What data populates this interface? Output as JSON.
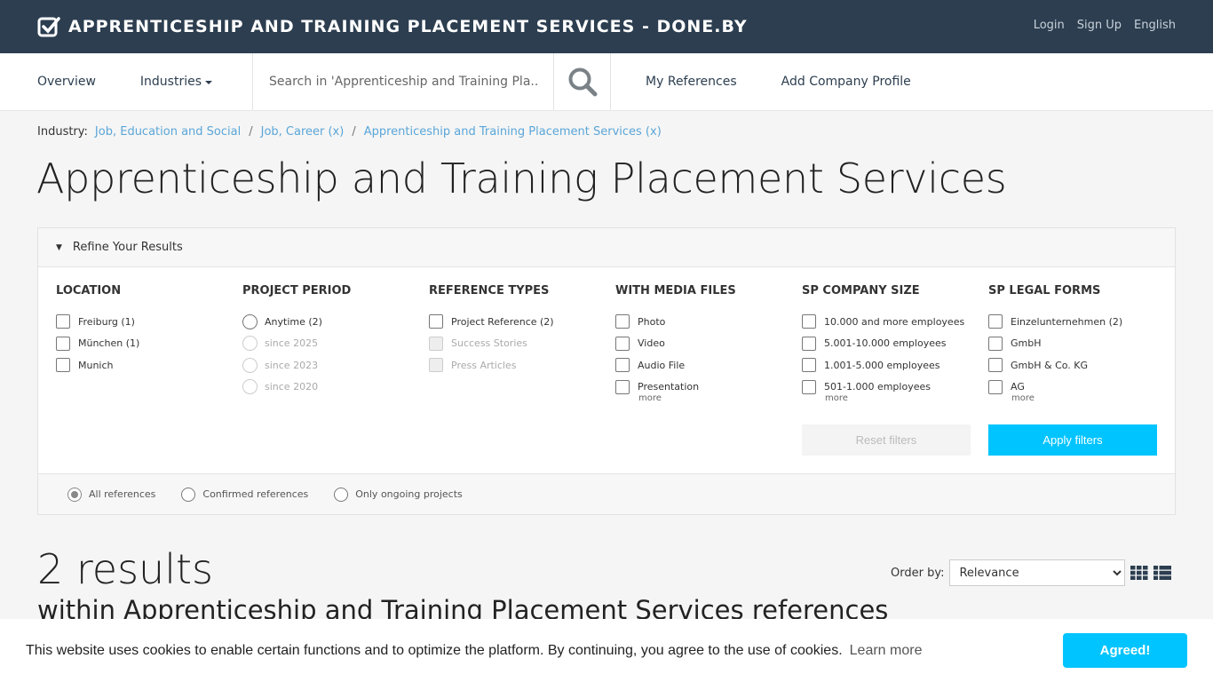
{
  "header": {
    "brand": "APPRENTICESHIP AND TRAINING PLACEMENT SERVICES - DONE.BY",
    "links": [
      "Login",
      "Sign Up",
      "English"
    ]
  },
  "nav": {
    "overview": "Overview",
    "industries": "Industries",
    "search_placeholder": "Search in 'Apprenticeship and Training Pla...",
    "my_references": "My References",
    "add_company": "Add Company Profile"
  },
  "breadcrumb": {
    "label": "Industry:",
    "items": [
      "Job, Education and Social",
      "Job, Career (x)",
      "Apprenticeship and Training Placement Services (x)"
    ]
  },
  "page_title": "Apprenticeship and Training Placement Services",
  "refine": {
    "header": "Refine Your Results",
    "columns": [
      {
        "title": "LOCATION",
        "options": [
          "Freiburg (1)",
          "München (1)",
          "Munich"
        ]
      },
      {
        "title": "PROJECT PERIOD",
        "options": [
          "Anytime (2)",
          "since 2025",
          "since 2023",
          "since 2020"
        ]
      },
      {
        "title": "REFERENCE TYPES",
        "options": [
          "Project Reference (2)",
          "Success Stories",
          "Press Articles"
        ]
      },
      {
        "title": "WITH MEDIA FILES",
        "options": [
          "Photo",
          "Video",
          "Audio File",
          "Presentation"
        ],
        "more": "more"
      },
      {
        "title": "SP COMPANY SIZE",
        "options": [
          "10.000 and more employees",
          "5.001-10.000 employees",
          "1.001-5.000 employees",
          "501-1.000 employees"
        ],
        "more": "more"
      },
      {
        "title": "SP LEGAL FORMS",
        "options": [
          "Einzelunternehmen (2)",
          "GmbH",
          "GmbH & Co. KG",
          "AG"
        ],
        "more": "more"
      }
    ],
    "reset": "Reset filters",
    "apply": "Apply filters",
    "footer_options": [
      "All references",
      "Confirmed references",
      "Only ongoing projects"
    ]
  },
  "results": {
    "count": "2 results",
    "subtitle": "within Apprenticeship and Training Placement Services references",
    "order_label": "Order by:",
    "order_value": "Relevance"
  },
  "cookie": {
    "text": "This website uses cookies to enable certain functions and to optimize the platform. By continuing, you agree to the use of cookies.",
    "learn_more": "Learn more",
    "button": "Agreed!"
  },
  "colors": {
    "topbar": "#2c3e50",
    "accent": "#00c4ff",
    "link": "#5aa6d8"
  }
}
